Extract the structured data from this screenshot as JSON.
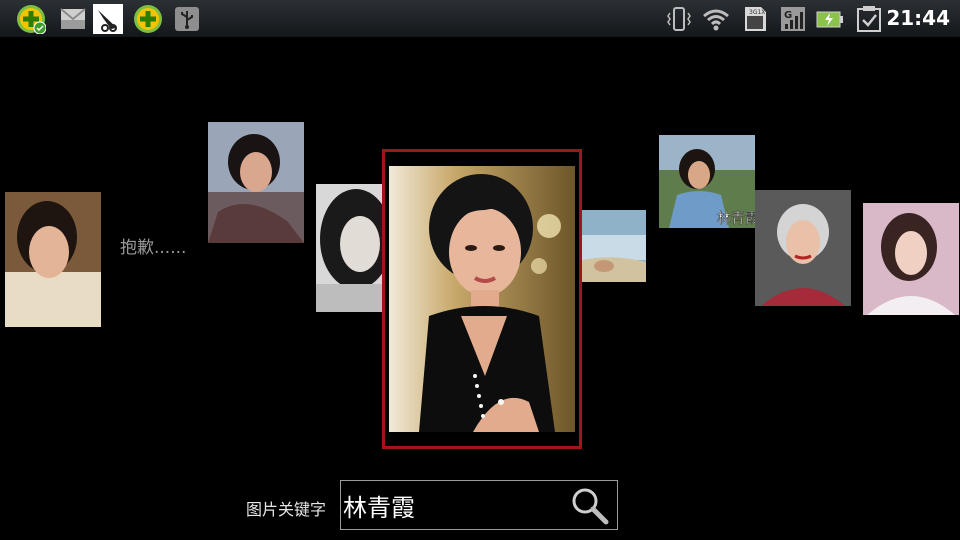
{
  "status_bar": {
    "time": "21:44",
    "left_icons": [
      "360-security-icon",
      "mail-icon",
      "bird-app-icon",
      "360-plus-icon",
      "usb-icon"
    ],
    "right_icons": [
      "vibrate-icon",
      "wifi-icon",
      "sd-card-icon",
      "signal-icon",
      "battery-charging-icon",
      "checkbox-icon"
    ]
  },
  "coverflow": {
    "sorry_text": "抱歉......",
    "items": [
      {
        "name": "photo-1"
      },
      {
        "name": "photo-2"
      },
      {
        "name": "photo-3"
      },
      {
        "name": "photo-selected"
      },
      {
        "name": "photo-5"
      },
      {
        "name": "photo-6"
      },
      {
        "name": "photo-7"
      },
      {
        "name": "photo-8"
      }
    ],
    "thumb_watermark": "林青霞"
  },
  "search": {
    "label": "图片关键字",
    "value": "林青霞"
  },
  "colors": {
    "selected_border": "#a31515",
    "background": "#000000"
  }
}
